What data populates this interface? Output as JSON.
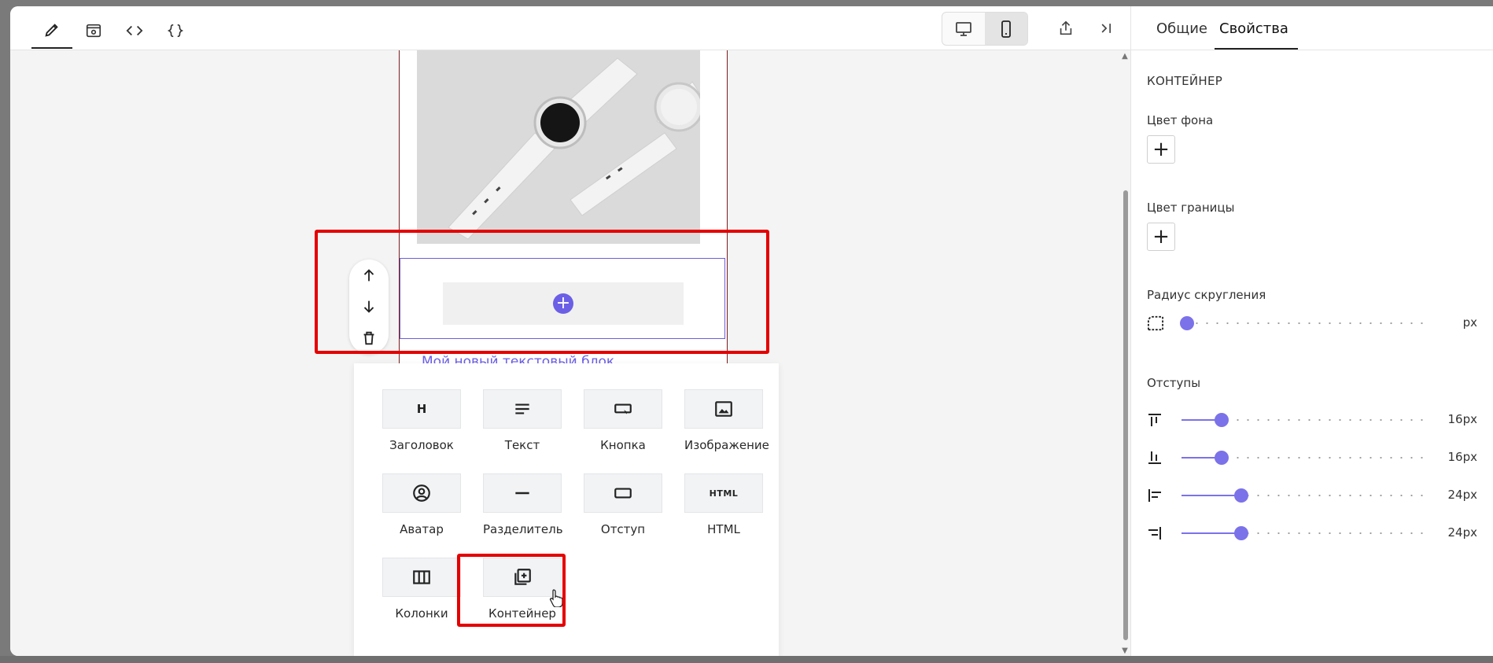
{
  "toolbar": {
    "tools": [
      "pencil-icon",
      "preview-icon",
      "code-icon",
      "braces-icon"
    ],
    "devices": [
      "desktop-icon",
      "mobile-icon"
    ],
    "selected_device": "mobile"
  },
  "canvas": {
    "text_block": "Мой новый текстовый блок",
    "block_controls": [
      "arrow-up-icon",
      "arrow-down-icon",
      "trash-icon"
    ]
  },
  "blocks": [
    {
      "label": "Заголовок",
      "icon": "heading-icon"
    },
    {
      "label": "Текст",
      "icon": "text-icon"
    },
    {
      "label": "Кнопка",
      "icon": "button-icon"
    },
    {
      "label": "Изображение",
      "icon": "image-icon"
    },
    {
      "label": "Аватар",
      "icon": "avatar-icon"
    },
    {
      "label": "Разделитель",
      "icon": "divider-icon"
    },
    {
      "label": "Отступ",
      "icon": "spacer-icon"
    },
    {
      "label": "HTML",
      "icon": "html-icon",
      "glyph": "HTML"
    },
    {
      "label": "Колонки",
      "icon": "columns-icon"
    },
    {
      "label": "Контейнер",
      "icon": "container-icon"
    }
  ],
  "heading_glyph": "H",
  "panel": {
    "tabs": [
      "Общие",
      "Свойства"
    ],
    "active_tab": "Свойства",
    "section_title": "КОНТЕЙНЕР",
    "bg_color_label": "Цвет фона",
    "border_color_label": "Цвет границы",
    "radius_label": "Радиус скругления",
    "radius_unit": "px",
    "radius_value_fraction": 0,
    "padding_label": "Отступы",
    "paddings": [
      {
        "name": "top",
        "value": "16px",
        "level": 0.16
      },
      {
        "name": "bottom",
        "value": "16px",
        "level": 0.16
      },
      {
        "name": "left",
        "value": "24px",
        "level": 0.24
      },
      {
        "name": "right",
        "value": "24px",
        "level": 0.24
      }
    ]
  },
  "colors": {
    "accent": "#6b5fe6",
    "highlight": "#e50000",
    "border_email": "#7a1e1e"
  }
}
